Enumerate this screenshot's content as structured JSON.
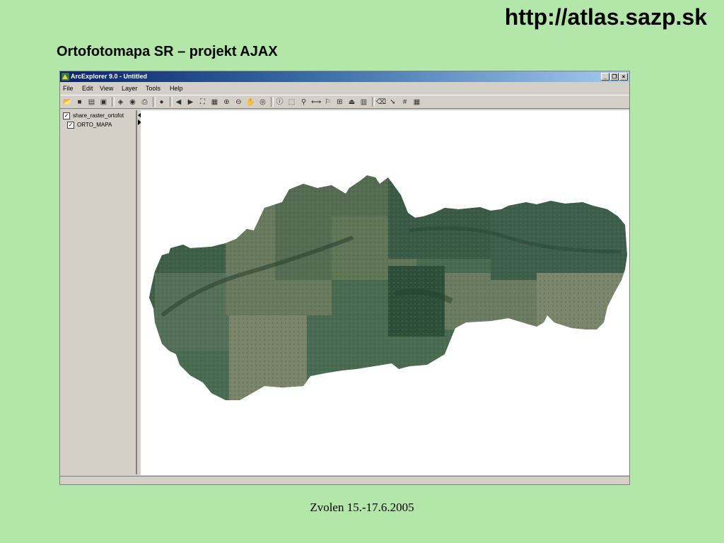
{
  "slide": {
    "url": "http://atlas.sazp.sk",
    "title": "Ortofotomapa SR – projekt AJAX",
    "footer": "Zvolen 15.-17.6.2005"
  },
  "window": {
    "title": "ArcExplorer 9.0 - Untitled",
    "controls": {
      "minimize": "_",
      "restore": "❐",
      "close": "×"
    }
  },
  "menu": {
    "items": [
      "File",
      "Edit",
      "View",
      "Layer",
      "Tools",
      "Help"
    ]
  },
  "toolbar": {
    "icons": [
      "open-icon",
      "save-icon",
      "save-all-icon",
      "export-icon",
      "add-layer-icon",
      "add-data-icon",
      "print-icon",
      "globe-icon",
      "back-icon",
      "forward-icon",
      "zoom-extent-icon",
      "zoom-layer-icon",
      "zoom-in-icon",
      "zoom-out-icon",
      "pan-icon",
      "full-extent-icon",
      "identify-icon",
      "select-icon",
      "find-icon",
      "measure-icon",
      "buffer-icon",
      "query-icon",
      "attributes-icon",
      "properties-icon",
      "eraser-icon",
      "pointer-icon",
      "grid-icon",
      "table-icon"
    ]
  },
  "toc": {
    "layers": [
      {
        "label": "share_raster_ortofot",
        "checked": true
      },
      {
        "label": "ORTO_MAPA",
        "checked": true
      }
    ]
  },
  "map": {
    "content": "orthophoto-raster"
  },
  "colors": {
    "background": "#b3e6a9",
    "titlebar_start": "#0a246a",
    "titlebar_end": "#a6caf0",
    "window_face": "#d4d0c8"
  }
}
